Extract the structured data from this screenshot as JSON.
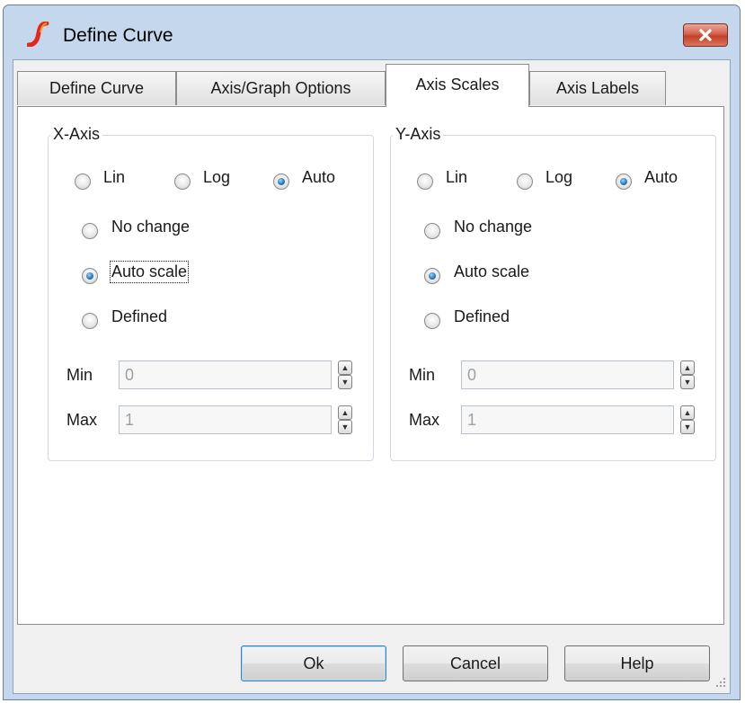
{
  "window": {
    "title": "Define Curve"
  },
  "tabs": [
    {
      "label": "Define Curve",
      "active": false
    },
    {
      "label": "Axis/Graph Options",
      "active": false
    },
    {
      "label": "Axis Scales",
      "active": true
    },
    {
      "label": "Axis Labels",
      "active": false
    }
  ],
  "x_axis": {
    "title": "X-Axis",
    "scale_type": {
      "options": [
        "Lin",
        "Log",
        "Auto"
      ],
      "selected": "Auto"
    },
    "range_mode": {
      "options": [
        "No change",
        "Auto scale",
        "Defined"
      ],
      "selected": "Auto scale"
    },
    "min": {
      "label": "Min",
      "value": "0"
    },
    "max": {
      "label": "Max",
      "value": "1"
    }
  },
  "y_axis": {
    "title": "Y-Axis",
    "scale_type": {
      "options": [
        "Lin",
        "Log",
        "Auto"
      ],
      "selected": "Auto"
    },
    "range_mode": {
      "options": [
        "No change",
        "Auto scale",
        "Defined"
      ],
      "selected": "Auto scale"
    },
    "min": {
      "label": "Min",
      "value": "0"
    },
    "max": {
      "label": "Max",
      "value": "1"
    }
  },
  "buttons": {
    "ok": "Ok",
    "cancel": "Cancel",
    "help": "Help"
  },
  "icons": {
    "app": "simetrix-curve-icon",
    "close": "close-icon",
    "spin_up": "spin-up-icon",
    "spin_down": "spin-down-icon",
    "grip": "resize-grip-icon"
  },
  "colors": {
    "title_bar": "#c4d7ec",
    "close_button": "#c7442e",
    "radio_selected": "#1d5f9e",
    "default_button_border": "#3c7fb1"
  },
  "focused_control": "x-axis-auto-scale"
}
